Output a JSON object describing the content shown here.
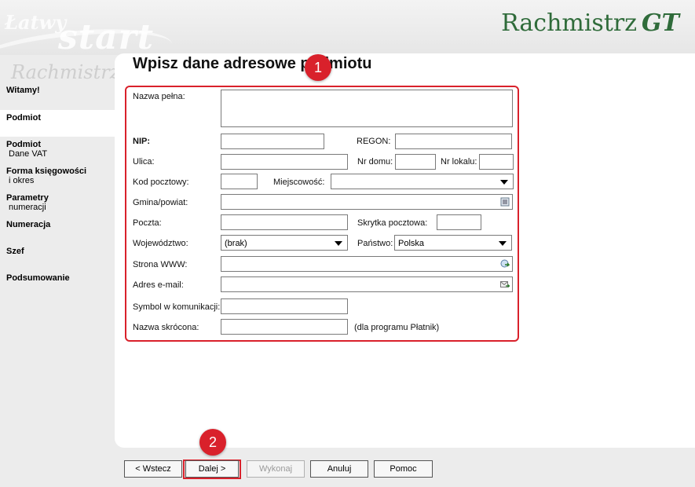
{
  "header": {
    "watermark_latwy": "Łatwy",
    "watermark_start": "start",
    "watermark_rachmistrz": "Rachmistrz",
    "brand_name": "Rachmistrz",
    "brand_suffix": "GT",
    "brand_color": "#2f6b3a"
  },
  "sidebar": {
    "items": [
      {
        "title": "Witamy!",
        "sub": ""
      },
      {
        "title": "Podmiot",
        "sub": ""
      },
      {
        "title": "Podmiot",
        "sub": "Dane VAT"
      },
      {
        "title": "Forma księgowości",
        "sub": "i okres"
      },
      {
        "title": "Parametry",
        "sub": "numeracji"
      },
      {
        "title": "Numeracja",
        "sub": ""
      },
      {
        "title": "Szef",
        "sub": ""
      },
      {
        "title": "Podsumowanie",
        "sub": ""
      }
    ]
  },
  "main": {
    "title": "Wpisz dane adresowe podmiotu",
    "marker1": "1",
    "marker2": "2"
  },
  "form": {
    "nazwa_pelna": "Nazwa pełna:",
    "nip": "NIP:",
    "regon": "REGON:",
    "ulica": "Ulica:",
    "nr_domu": "Nr domu:",
    "nr_lokalu": "Nr lokalu:",
    "kod_pocztowy": "Kod pocztowy:",
    "miejscowosc": "Miejscowość:",
    "gmina": "Gmina/powiat:",
    "poczta": "Poczta:",
    "skrytka": "Skrytka pocztowa:",
    "wojewodztwo": "Województwo:",
    "wojewodztwo_value": "(brak)",
    "panstwo": "Państwo:",
    "panstwo_value": "Polska",
    "strona_www": "Strona WWW:",
    "email": "Adres e-mail:",
    "symbol": "Symbol w komunikacji:",
    "nazwa_skrocona": "Nazwa skrócona:",
    "platnik_note": "(dla programu Płatnik)"
  },
  "buttons": {
    "wstecz": "< Wstecz",
    "dalej": "Dalej >",
    "wykonaj": "Wykonaj",
    "anuluj": "Anuluj",
    "pomoc": "Pomoc"
  },
  "colors": {
    "highlight": "#d9212b"
  }
}
